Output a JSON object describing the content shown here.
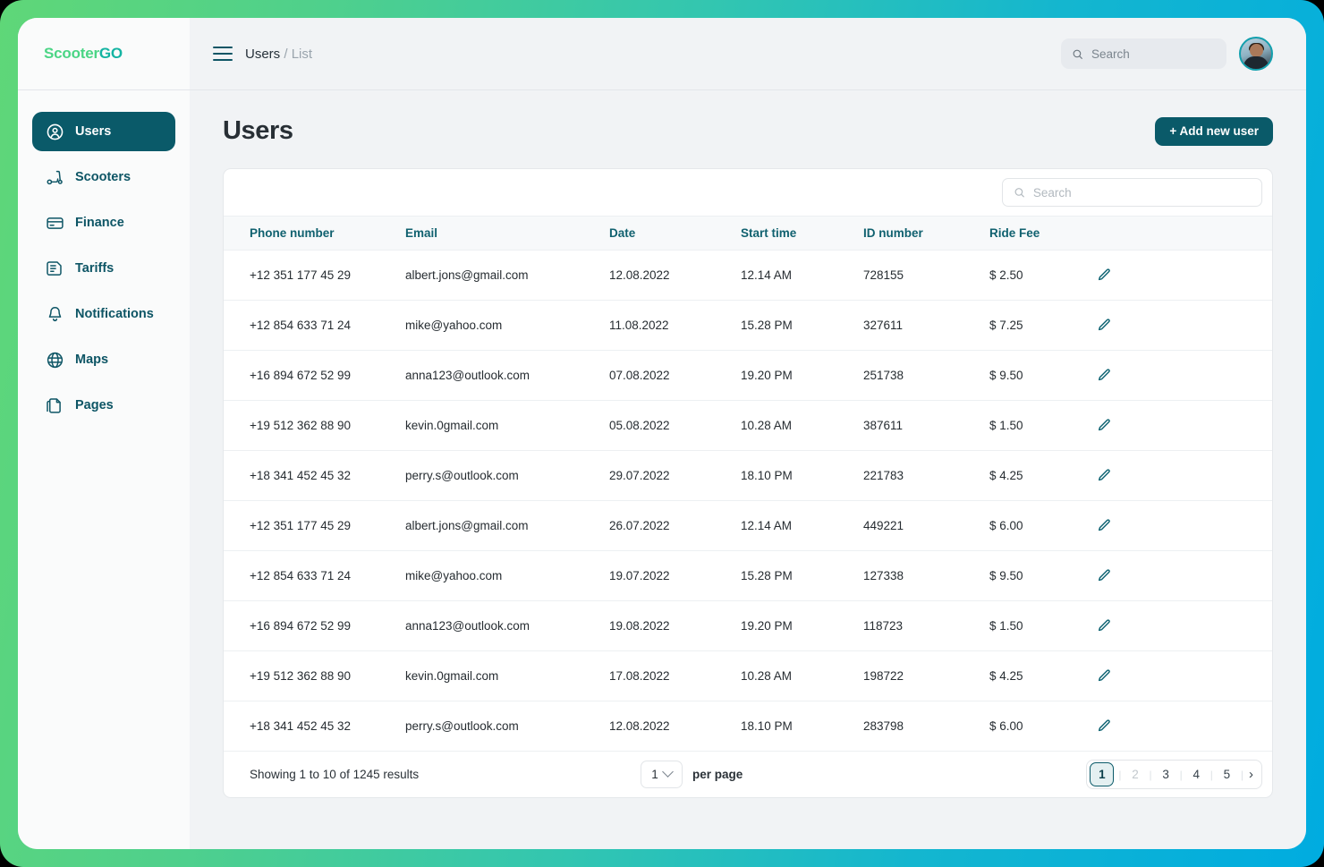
{
  "brand": {
    "name_part1": "Scooter",
    "name_part2": "GO",
    "color_green": "#4bd585",
    "color_teal": "#14b4a2"
  },
  "topbar": {
    "breadcrumb_current": "Users",
    "breadcrumb_separator": "/",
    "breadcrumb_parent": "List",
    "search_placeholder": "Search",
    "search_value": ""
  },
  "sidebar": {
    "items": [
      {
        "label": "Users",
        "icon": "user-circle-icon",
        "active": true
      },
      {
        "label": "Scooters",
        "icon": "scooter-icon",
        "active": false
      },
      {
        "label": "Finance",
        "icon": "credit-card-icon",
        "active": false
      },
      {
        "label": "Tariffs",
        "icon": "document-icon",
        "active": false
      },
      {
        "label": "Notifications",
        "icon": "bell-icon",
        "active": false
      },
      {
        "label": "Maps",
        "icon": "globe-icon",
        "active": false
      },
      {
        "label": "Pages",
        "icon": "pages-icon",
        "active": false
      }
    ]
  },
  "page": {
    "title": "Users",
    "add_button_label": "+ Add new user",
    "accent_color": "#0a5a69"
  },
  "table": {
    "search_placeholder": "Search",
    "search_value": "",
    "columns": [
      "Phone number",
      "Email",
      "Date",
      "Start time",
      "ID number",
      "Ride Fee"
    ],
    "edit_icon": "pencil-icon",
    "rows": [
      {
        "phone": "+12 351 177 45 29",
        "email": "albert.jons@gmail.com",
        "date": "12.08.2022",
        "start_time": "12.14 AM",
        "id_number": "728155",
        "ride_fee": "$ 2.50"
      },
      {
        "phone": "+12 854 633 71 24",
        "email": "mike@yahoo.com",
        "date": "11.08.2022",
        "start_time": "15.28 PM",
        "id_number": "327611",
        "ride_fee": "$ 7.25"
      },
      {
        "phone": "+16 894 672 52 99",
        "email": "anna123@outlook.com",
        "date": "07.08.2022",
        "start_time": "19.20 PM",
        "id_number": "251738",
        "ride_fee": "$ 9.50"
      },
      {
        "phone": "+19 512 362 88 90",
        "email": "kevin.0gmail.com",
        "date": "05.08.2022",
        "start_time": "10.28 AM",
        "id_number": "387611",
        "ride_fee": "$ 1.50"
      },
      {
        "phone": "+18 341 452 45 32",
        "email": "perry.s@outlook.com",
        "date": "29.07.2022",
        "start_time": "18.10 PM",
        "id_number": "221783",
        "ride_fee": "$ 4.25"
      },
      {
        "phone": "+12 351 177 45 29",
        "email": "albert.jons@gmail.com",
        "date": "26.07.2022",
        "start_time": "12.14 AM",
        "id_number": "449221",
        "ride_fee": "$ 6.00"
      },
      {
        "phone": "+12 854 633 71 24",
        "email": "mike@yahoo.com",
        "date": "19.07.2022",
        "start_time": "15.28 PM",
        "id_number": "127338",
        "ride_fee": "$ 9.50"
      },
      {
        "phone": "+16 894 672 52 99",
        "email": "anna123@outlook.com",
        "date": "19.08.2022",
        "start_time": "19.20 PM",
        "id_number": "118723",
        "ride_fee": "$ 1.50"
      },
      {
        "phone": "+19 512 362 88 90",
        "email": "kevin.0gmail.com",
        "date": "17.08.2022",
        "start_time": "10.28 AM",
        "id_number": "198722",
        "ride_fee": "$ 4.25"
      },
      {
        "phone": "+18 341 452 45 32",
        "email": "perry.s@outlook.com",
        "date": "12.08.2022",
        "start_time": "18.10 PM",
        "id_number": "283798",
        "ride_fee": "$ 6.00"
      }
    ]
  },
  "footer": {
    "showing_text": "Showing 1 to 10 of 1245 results",
    "per_page_value": "1",
    "per_page_label": "per page",
    "pages": [
      "1",
      "2",
      "3",
      "4",
      "5"
    ],
    "active_page": "1",
    "next_label": "›"
  }
}
